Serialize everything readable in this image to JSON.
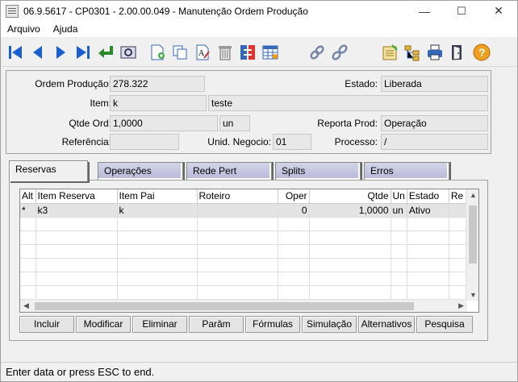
{
  "window": {
    "title": "06.9.5617 - CP0301 - 2.00.00.049 - Manutenção Ordem Produção",
    "minimize": "—",
    "maximize": "☐",
    "close": "✕"
  },
  "menu": [
    "Arquivo",
    "Ajuda"
  ],
  "toolbar": {
    "icons": [
      "first-icon",
      "prev-icon",
      "next-icon",
      "last-icon",
      "return-icon",
      "zoom-icon",
      "new-icon",
      "copy-icon",
      "edit-icon",
      "delete-icon",
      "swap-icon",
      "table-icon",
      "link-icon",
      "unlink-icon",
      "report-icon",
      "tree-icon",
      "print-icon",
      "exit-icon",
      "help-icon"
    ]
  },
  "form": {
    "ordem_label": "Ordem Produção:",
    "ordem_value": "278.322",
    "estado_label": "Estado:",
    "estado_value": "Liberada",
    "item_label": "Item:",
    "item_code": "k",
    "item_desc": "teste",
    "qtde_label": "Qtde Ord:",
    "qtde_value": "1,0000",
    "qtde_unit": "un",
    "reporta_label": "Reporta Prod:",
    "reporta_value": "Operação",
    "referencia_label": "Referência:",
    "referencia_value": "",
    "unid_label": "Unid. Negocio:",
    "unid_value": "01",
    "processo_label": "Processo:",
    "processo_value": "/"
  },
  "tabs": [
    "Reservas",
    "Operações",
    "Rede Pert",
    "Splits",
    "Erros"
  ],
  "active_tab": "Reservas",
  "grid": {
    "columns": [
      "Alt",
      "Item Reserva",
      "Item Pai",
      "Roteiro",
      "Oper",
      "Qtde",
      "Un",
      "Estado",
      "Re"
    ],
    "rows": [
      [
        "*",
        "k3",
        "k",
        "",
        "0",
        "1,0000",
        "un",
        "Ativo",
        ""
      ]
    ]
  },
  "buttons": [
    "Incluir",
    "Modificar",
    "Eliminar",
    "Parâm",
    "Fórmulas",
    "Simulação",
    "Alternativos",
    "Pesquisa"
  ],
  "status_text": "Enter data or press ESC to end."
}
